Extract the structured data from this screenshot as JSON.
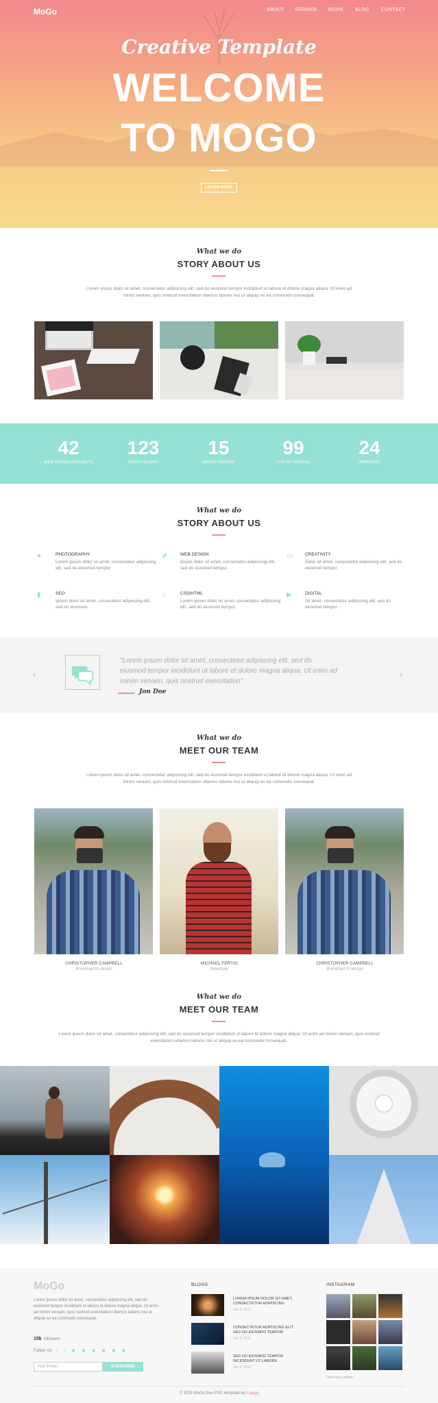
{
  "header": {
    "logo": "MoGo",
    "nav": [
      "ABOUT",
      "SERVICE",
      "WORK",
      "BLOG",
      "CONTACT"
    ]
  },
  "hero": {
    "subtitle": "Creative Template",
    "title_line1": "WELCOME",
    "title_line2": "TO MOGO",
    "button": "LEARN MORE"
  },
  "about": {
    "small": "What we do",
    "title": "STORY ABOUT US",
    "text": "Lorem ipsum dolor sit amet, consectetur adipiscing elit, sed do eiusmod tempor incididunt ut labore et dolore magna aliqua. Ut enim ad minim veniam, quis nostrud exercitation ullamco laboris nisi ut aliquip ex ea commodo consequat."
  },
  "stats": [
    {
      "number": "42",
      "label": "WEB DESIGN PROJECTS"
    },
    {
      "number": "123",
      "label": "HAPPY CLIENT"
    },
    {
      "number": "15",
      "label": "AWARD WINNER"
    },
    {
      "number": "99",
      "label": "CUP OF COFFEE"
    },
    {
      "number": "24",
      "label": "MEMBERS"
    }
  ],
  "services": {
    "small": "What we do",
    "title": "STORY ABOUT US",
    "items": [
      {
        "icon": "alarm-icon",
        "title": "PHOTOGRAPHY",
        "text": "Lorem ipsum dolor sit amet, consectetur adipiscing elit, sed do eiusmod tempor."
      },
      {
        "icon": "chart-icon",
        "title": "WEB DESIGN",
        "text": "Ipsum dolor sit amet, consectetur adipiscing elit, sed do eiusmod tempor."
      },
      {
        "icon": "monitor-icon",
        "title": "CREATIVITY",
        "text": "Dolor sit amet, consectetur adipiscing elit, sed do eiusmod tempor."
      },
      {
        "icon": "book-icon",
        "title": "SEO",
        "text": "Ipsum dolor sit amet, consectetur adipiscing elit, sed do eiusmod."
      },
      {
        "icon": "home-icon",
        "title": "CSS/HTML",
        "text": "Lorem ipsum dolor sit amet, consectetur adipiscing elit, sed do eiusmod tempor."
      },
      {
        "icon": "video-icon",
        "title": "DIGITAL",
        "text": "Sit amet, consectetur adipiscing elit, sed do eiusmod tempor."
      }
    ]
  },
  "testimonial": {
    "quote": "\"Lorem ipsum dolor sit amet, consectetur adipiscing elit, sed do eiusmod tempor incididunt ut labore et dolore magna aliqua. Ut enim ad minim veniam, quis nostrud exercitation\"",
    "author": "Jon Doe",
    "prev": "‹",
    "next": "›"
  },
  "team": {
    "small": "What we do",
    "title": "MEET OUR TEAM",
    "text": "Lorem ipsum dolor sit amet, consectetur adipiscing elit, sed do eiusmod tempor incididunt ut labore et dolore magna aliqua. Ut enim ad minim veniam, quis nostrud exercitation ullamco laboris nisi ut aliquip ex ea commodo consequat.",
    "members": [
      {
        "name": "CHRISTOPHER CAMPBELL",
        "role": "Branding/UX design"
      },
      {
        "name": "MICHAEL FERTIG",
        "role": "Developer"
      },
      {
        "name": "CHRISTOPHER CAMPBELL",
        "role": "Branding/UX design"
      }
    ]
  },
  "team2": {
    "small": "What we do",
    "title": "MEET OUR TEAM",
    "text": "Lorem ipsum dolor sit amet, consectetur adipiscing elit, sed do eiusmod tempor incididunt ut labore et dolore magna aliqua. Ut enim ad minim veniam, quis nostrud exercitation ullamco laboris nisi ut aliquip ex ea commodo consequat."
  },
  "footer": {
    "logo": "MoGo",
    "text": "Lorem ipsum dolor sit amet, consectetur adipiscing elit, sed do eiusmod tempor incididunt ut labore et dolore magna aliqua. Ut enim ad minim veniam, quis nostrud exercitation ullamco laboris nisi ut aliquip ex ea commodo consequat.",
    "followers_count": "15k",
    "followers_label": "followers",
    "follow_us": "Follow Us:",
    "email_placeholder": "Your Email...",
    "subscribe": "SUBSCRIBE",
    "blogs_title": "BLOGS",
    "blogs": [
      {
        "title": "LOREM IPSUM DOLOR SIT AMET, CONSECTETUR ADIPISCING",
        "date": "Jan 9, 2016"
      },
      {
        "title": "CONSECTETUR ADIPISCING ELIT, SED DO EIUSMOD TEMPOR",
        "date": "Jan 9, 2016"
      },
      {
        "title": "SED DO EIUSMOD TEMPOR INCIDIDUNT UT LABORE",
        "date": "Jan 9, 2016"
      }
    ],
    "instagram_title": "INSTAGRAM",
    "view_more": "View more photos",
    "copyright": "© 2016 MoGo free PSD template by",
    "author_link": "Laaqiq",
    "accent": "#f08a8a"
  },
  "colors": {
    "mint": "#95e1d3",
    "coral": "#f38181",
    "hero_top": "#f3888e",
    "hero_bottom": "#f8d98f"
  }
}
